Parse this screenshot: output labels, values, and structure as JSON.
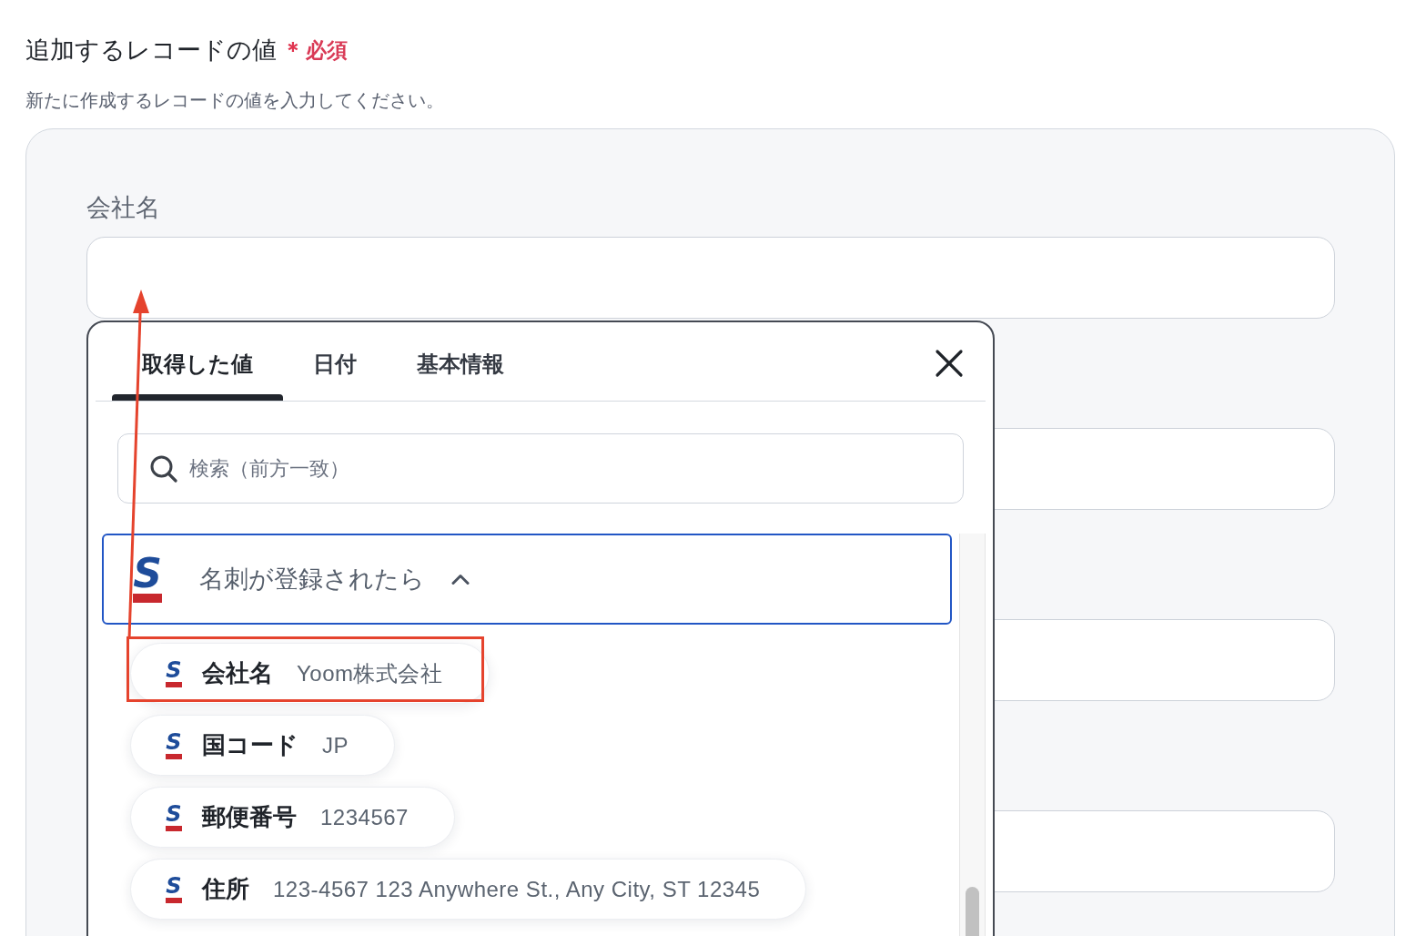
{
  "section": {
    "title": "追加するレコードの値",
    "required_mark": "＊",
    "required_label": "必須",
    "description": "新たに作成するレコードの値を入力してください。"
  },
  "form": {
    "fields": [
      {
        "kind": "text",
        "label": "会社名"
      },
      {
        "kind": "text"
      },
      {
        "kind": "text"
      },
      {
        "kind": "text"
      }
    ]
  },
  "value_picker": {
    "tabs": [
      {
        "label": "取得した値",
        "selected": true
      },
      {
        "label": "日付",
        "selected": false
      },
      {
        "label": "基本情報",
        "selected": false
      }
    ],
    "search": {
      "placeholder": "検索（前方一致）"
    },
    "groups": [
      {
        "logo": "S",
        "title": "名刺が登録されたら",
        "expanded": true,
        "focused": true,
        "items": [
          {
            "logo": "S",
            "name": "会社名",
            "value": "Yoom株式会社",
            "highlighted": true
          },
          {
            "logo": "S",
            "name": "国コード",
            "value": "JP",
            "highlighted": false
          },
          {
            "logo": "S",
            "name": "郵便番号",
            "value": "1234567",
            "highlighted": false
          },
          {
            "logo": "S",
            "name": "住所",
            "value": "123-4567 123 Anywhere St., Any City, ST 12345",
            "highlighted": false
          }
        ]
      }
    ]
  },
  "annotation": {
    "kind": "arrow"
  }
}
